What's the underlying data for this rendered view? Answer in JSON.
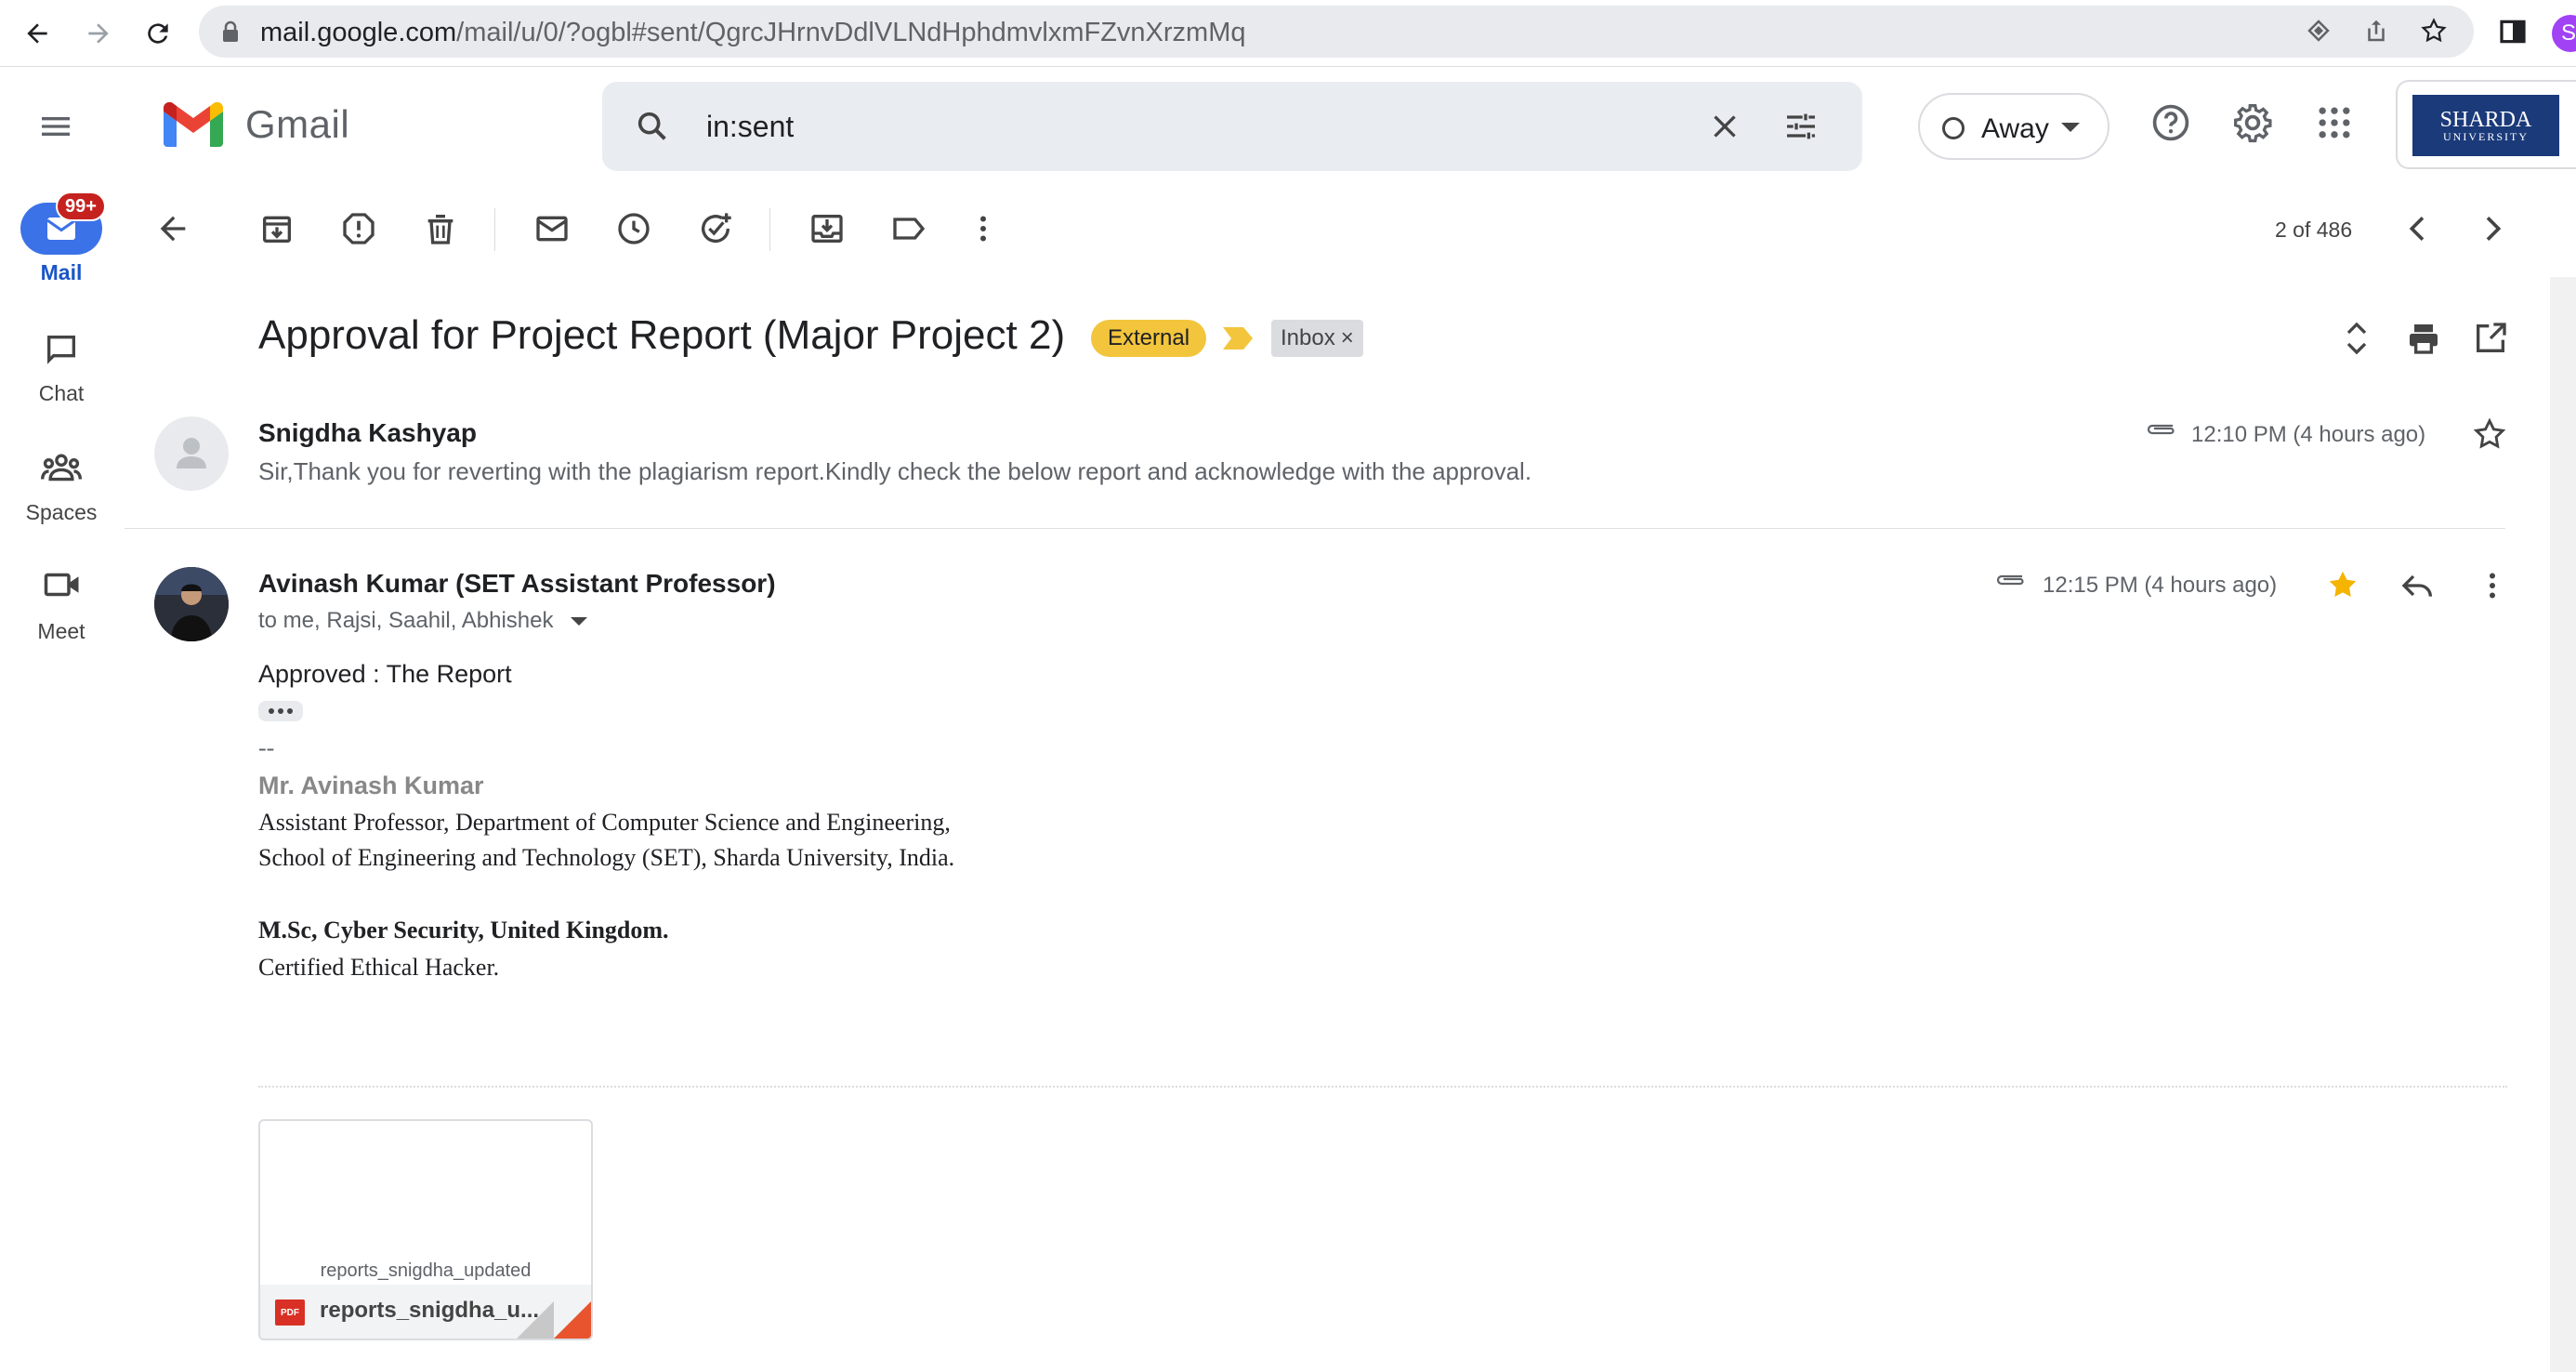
{
  "browser": {
    "url_host": "mail.google.com",
    "url_path": "/mail/u/0/?ogbl#sent/QgrcJHrnvDdlVLNdHphdmvlxmFZvnXrzmMq",
    "profile_initial": "S"
  },
  "app": {
    "name": "Gmail"
  },
  "search": {
    "query": "in:sent"
  },
  "status": {
    "label": "Away"
  },
  "account": {
    "org_line1": "SHARDA",
    "org_line2": "UNIVERSITY"
  },
  "rail": {
    "items": [
      {
        "label": "Mail",
        "icon": "mail-icon"
      },
      {
        "label": "Chat",
        "icon": "chat-icon"
      },
      {
        "label": "Spaces",
        "icon": "spaces-icon"
      },
      {
        "label": "Meet",
        "icon": "meet-icon"
      }
    ],
    "mail_badge": "99+"
  },
  "toolbar": {
    "pager": "2 of 486"
  },
  "thread": {
    "subject": "Approval for Project Report (Major Project 2)",
    "labels": {
      "external": "External",
      "inbox": "Inbox",
      "inbox_remove": "×"
    }
  },
  "messages": [
    {
      "sender": "Snigdha Kashyap",
      "snippet": "Sir,Thank you for reverting with the plagiarism report.Kindly check the below report and acknowledge with the approval.",
      "time": "12:10 PM (4 hours ago)",
      "starred": false
    },
    {
      "sender": "Avinash Kumar (SET Assistant Professor)",
      "recipients": "to me, Rajsi, Saahil, Abhishek",
      "time": "12:15 PM (4 hours ago)",
      "starred": true,
      "body": "Approved : The Report",
      "signature": {
        "separator": "--",
        "name": "Mr. Avinash Kumar",
        "line1": "Assistant Professor, Department of Computer Science and Engineering,",
        "line2": "School of Engineering and Technology (SET), Sharda University, India.",
        "line3": "M.Sc, Cyber Security, United Kingdom.",
        "line4": "Certified Ethical Hacker."
      },
      "attachment": {
        "preview_text": "reports_snigdha_updated",
        "name": "reports_snigdha_u...",
        "type": "PDF"
      }
    }
  ],
  "colors": {
    "accent": "#3b72e8",
    "external_label": "#f2c53d",
    "star": "#f4b400",
    "badge": "#c5221f"
  }
}
